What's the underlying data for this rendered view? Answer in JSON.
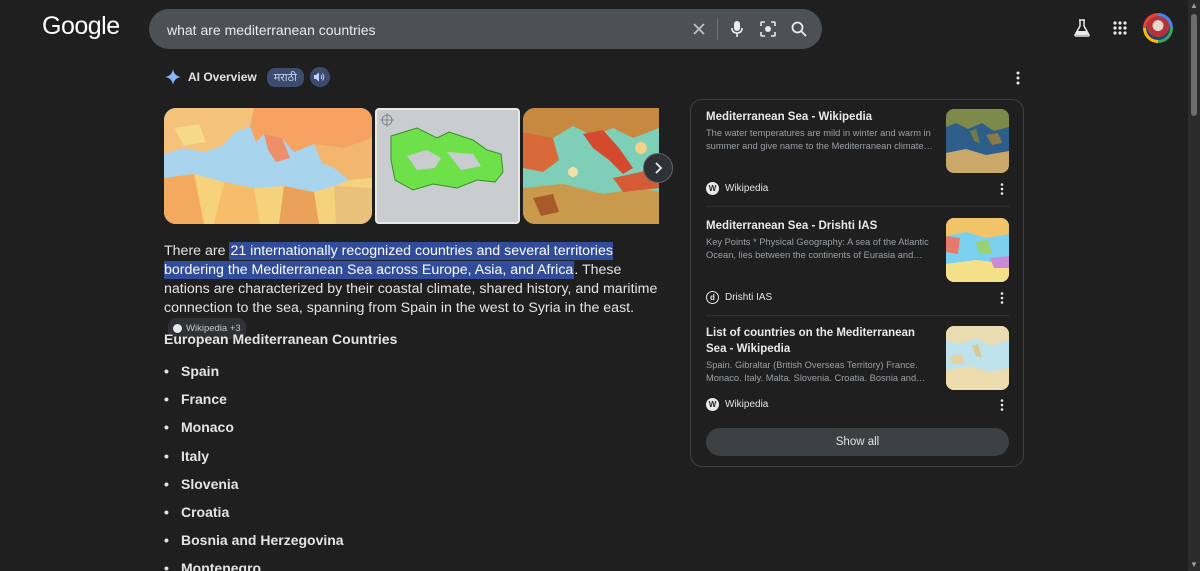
{
  "header": {
    "logo": "Google",
    "search": {
      "value": "what are mediterranean countries",
      "icons": [
        "clear-icon",
        "mic-icon",
        "lens-icon",
        "search-icon"
      ]
    },
    "right_icons": [
      "labs-flask-icon",
      "apps-grid-icon",
      "account-avatar"
    ]
  },
  "ai_overview": {
    "title": "AI Overview",
    "language_chip": "मराठी",
    "speak_icon": "speaker-icon",
    "images": [
      "mediterranean-political-map",
      "mediterranean-region-green-map",
      "illustrated-italy-spain-map"
    ],
    "answer": {
      "prefix": "There are ",
      "highlight": "21 internationally recognized countries and several territories bordering the Mediterranean Sea across Europe, Asia, and Africa",
      "suffix": ". These nations are characterized by their coastal climate, shared history, and maritime connection to the sea, spanning from Spain in the west to Syria in the east.",
      "source_chip": "Wikipedia +3"
    },
    "section_heading": "European Mediterranean Countries",
    "countries": [
      "Spain",
      "France",
      "Monaco",
      "Italy",
      "Slovenia",
      "Croatia",
      "Bosnia and Herzegovina",
      "Montenegro"
    ]
  },
  "sources": {
    "cards": [
      {
        "title": "Mediterranean Sea - Wikipedia",
        "snippet": "The water temperatures are mild in winter and warm in summer and give name to the Mediterranean climate…",
        "site": "Wikipedia",
        "favicon": "W"
      },
      {
        "title": "Mediterranean Sea - Drishti IAS",
        "snippet": "Key Points * Physical Geography: A sea of the Atlantic Ocean, lies between the continents of Eurasia and…",
        "site": "Drishti IAS",
        "favicon": "d"
      },
      {
        "title": "List of countries on the Mediterranean Sea - Wikipedia",
        "snippet": "Spain. Gibraltar (British Overseas Territory) France. Monaco. Italy. Malta. Slovenia. Croatia. Bosnia and…",
        "site": "Wikipedia",
        "favicon": "W"
      }
    ],
    "show_all": "Show all"
  },
  "colors": {
    "background": "#1f1f1f",
    "highlight": "#304c9b",
    "search_bar": "#4d5156",
    "chip": "#3c4b6e"
  }
}
